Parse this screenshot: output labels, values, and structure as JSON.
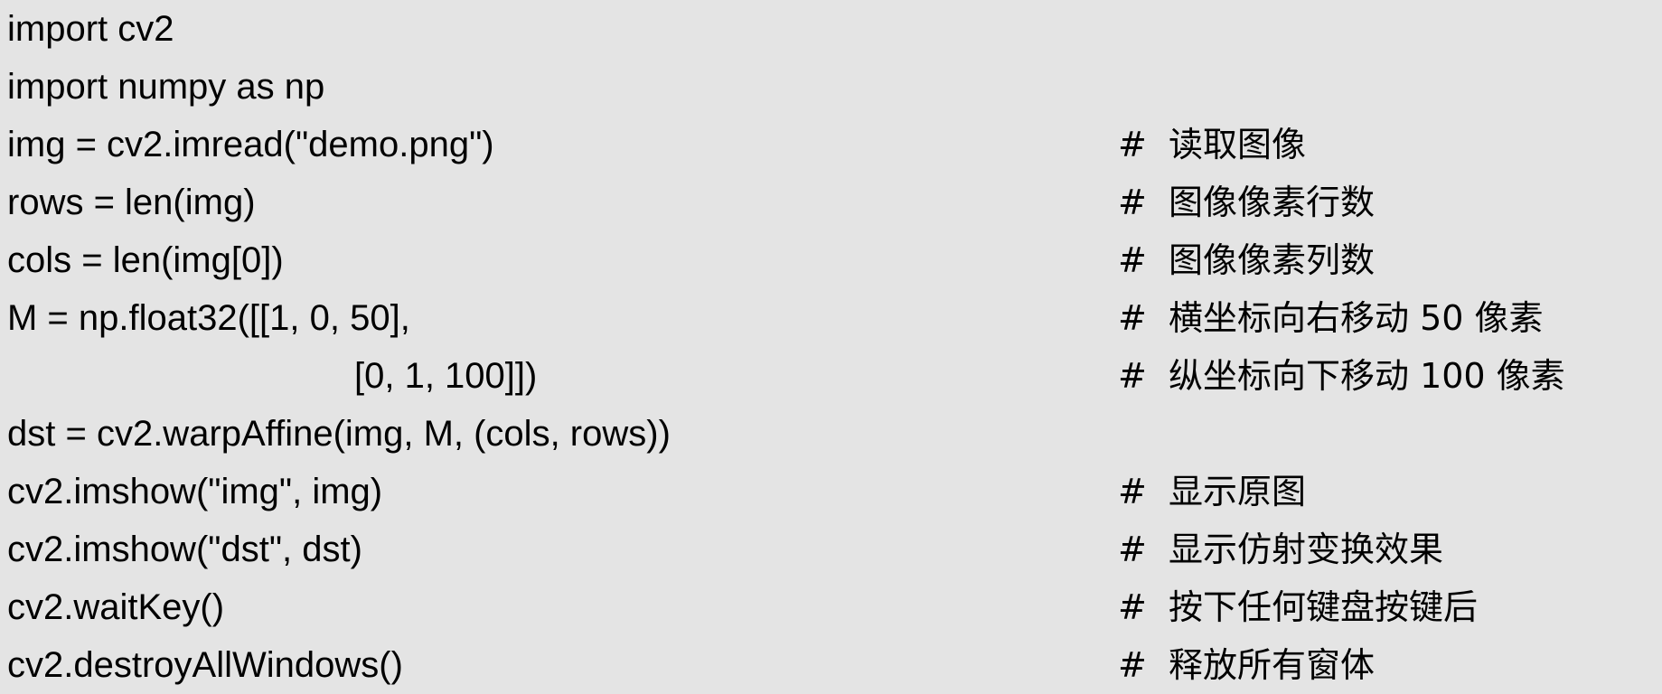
{
  "code_lines": [
    {
      "code": "import cv2",
      "comment": ""
    },
    {
      "code": "import numpy as np",
      "comment": ""
    },
    {
      "code": "img = cv2.imread(\"demo.png\")",
      "comment": "#  读取图像"
    },
    {
      "code": "rows = len(img)",
      "comment": "#  图像像素行数"
    },
    {
      "code": "cols = len(img[0])",
      "comment": "#  图像像素列数"
    },
    {
      "code": "M = np.float32([[1, 0, 50],",
      "comment": "#  横坐标向右移动 50 像素"
    },
    {
      "code": "[0, 1, 100]])",
      "comment": "#  纵坐标向下移动 100 像素"
    },
    {
      "code": "dst = cv2.warpAffine(img, M, (cols, rows))",
      "comment": ""
    },
    {
      "code": "cv2.imshow(\"img\", img)",
      "comment": "#  显示原图"
    },
    {
      "code": "cv2.imshow(\"dst\", dst)",
      "comment": "#  显示仿射变换效果"
    },
    {
      "code": "cv2.waitKey()",
      "comment": "#  按下任何键盘按键后"
    },
    {
      "code": "cv2.destroyAllWindows()",
      "comment": "#  释放所有窗体"
    }
  ]
}
